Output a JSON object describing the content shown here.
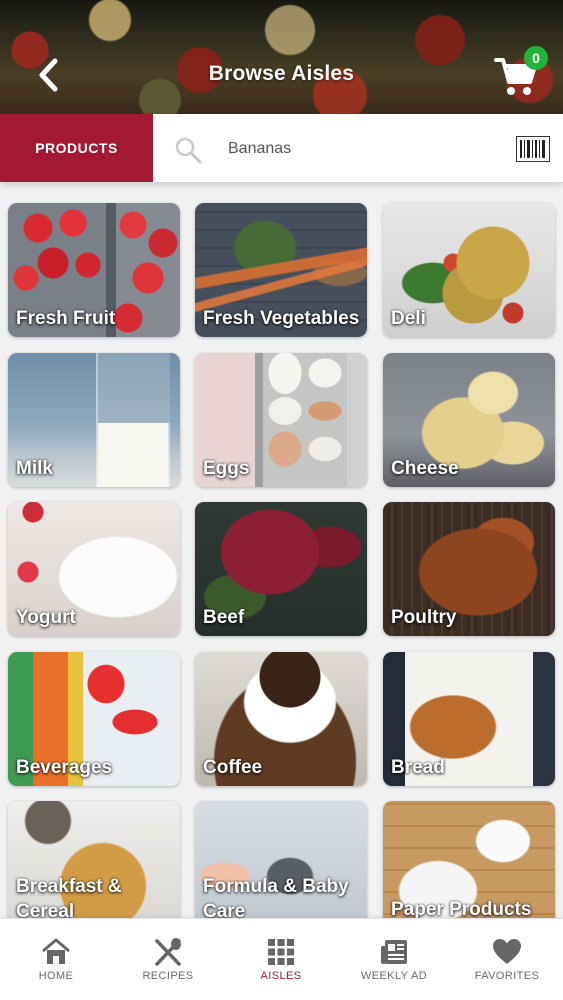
{
  "header": {
    "title": "Browse Aisles",
    "cart_count": "0",
    "back_icon": "chevron-left-icon",
    "cart_icon": "shopping-cart-icon"
  },
  "search": {
    "tab_label": "PRODUCTS",
    "value": "",
    "placeholder": "Bananas",
    "search_icon": "search-icon",
    "barcode_icon": "barcode-icon"
  },
  "aisles": [
    {
      "label": "Fresh Fruit"
    },
    {
      "label": "Fresh Vegetables"
    },
    {
      "label": "Deli"
    },
    {
      "label": "Milk"
    },
    {
      "label": "Eggs"
    },
    {
      "label": "Cheese"
    },
    {
      "label": "Yogurt"
    },
    {
      "label": "Beef"
    },
    {
      "label": "Poultry"
    },
    {
      "label": "Beverages"
    },
    {
      "label": "Coffee"
    },
    {
      "label": "Bread"
    },
    {
      "label": "Breakfast & Cereal"
    },
    {
      "label": "Formula & Baby Care"
    },
    {
      "label": "Paper Products"
    }
  ],
  "tabbar": {
    "active": "AISLES",
    "items": [
      {
        "label": "HOME",
        "icon": "home-icon"
      },
      {
        "label": "RECIPES",
        "icon": "utensils-icon"
      },
      {
        "label": "AISLES",
        "icon": "grid-icon"
      },
      {
        "label": "WEEKLY AD",
        "icon": "newspaper-icon"
      },
      {
        "label": "FAVORITES",
        "icon": "heart-icon"
      }
    ]
  },
  "colors": {
    "accent": "#a31832",
    "badge": "#22b43a",
    "tab_inactive": "#6a6a6a"
  }
}
